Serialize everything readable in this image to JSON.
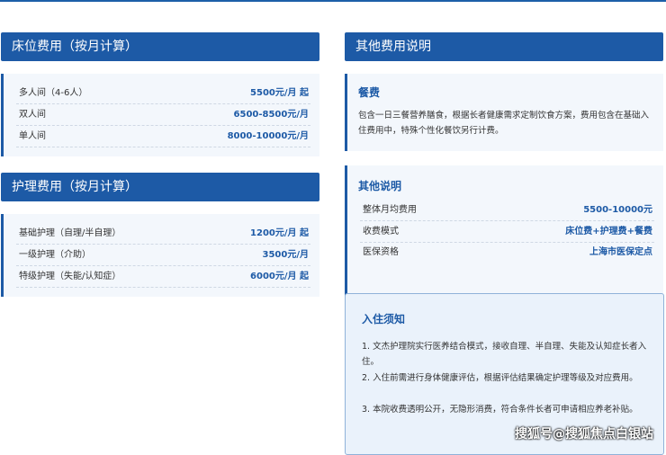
{
  "bed_fees": {
    "title": "床位费用（按月计算）",
    "rows": [
      {
        "label": "多人间（4-6人）",
        "value": "5500元/月 起"
      },
      {
        "label": "双人间",
        "value": "6500-8500元/月"
      },
      {
        "label": "单人间",
        "value": "8000-10000元/月"
      }
    ]
  },
  "care_fees": {
    "title": "护理费用（按月计算）",
    "rows": [
      {
        "label": "基础护理（自理/半自理）",
        "value": "1200元/月 起"
      },
      {
        "label": "一级护理（介助）",
        "value": "3500元/月"
      },
      {
        "label": "特级护理（失能/认知症）",
        "value": "6000元/月 起"
      }
    ]
  },
  "other_fees": {
    "title": "其他费用说明",
    "meals": {
      "title": "餐费",
      "text": "包含一日三餐营养膳食，根据长者健康需求定制饮食方案，费用包含在基础入住费用中，特殊个性化餐饮另行计费。"
    },
    "notes": {
      "title": "其他说明",
      "rows": [
        {
          "label": "整体月均费用",
          "value": "5500-10000元"
        },
        {
          "label": "收费模式",
          "value": "床位费+护理费+餐费"
        },
        {
          "label": "医保资格",
          "value": "上海市医保定点"
        }
      ]
    }
  },
  "admission": {
    "title": "入住须知",
    "items": [
      "1. 文杰护理院实行医养结合模式，接收自理、半自理、失能及认知症长者入住。",
      "2. 入住前需进行身体健康评估，根据评估结果确定护理等级及对应费用。",
      "3. 本院收费透明公开，无隐形消费，符合条件长者可申请相应养老补贴。"
    ]
  },
  "watermark": "搜狐号@搜狐焦点白银站",
  "colors": {
    "accent": "#1d5aa6",
    "panel_bg": "#f3f7fc",
    "notice_bg": "#eaf2fb"
  }
}
